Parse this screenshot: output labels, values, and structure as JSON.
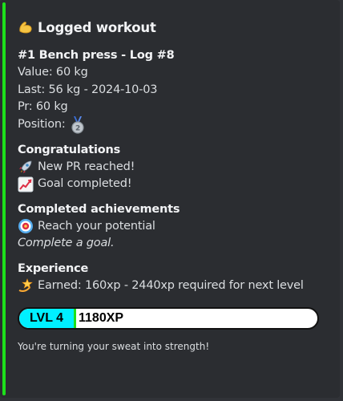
{
  "embed": {
    "accent_color": "#1ee01b",
    "title": "Logged workout",
    "title_icon": "flexed-biceps-icon",
    "log": {
      "heading": "#1 Bench press - Log #8",
      "value": "Value: 60 kg",
      "last": "Last: 56 kg - 2024-10-03",
      "pr": "Pr: 60 kg",
      "position": "Position:",
      "position_icon": "second-place-medal-icon"
    },
    "congratulations": {
      "heading": "Congratulations",
      "items": [
        {
          "icon": "rocket-icon",
          "text": "New PR reached!"
        },
        {
          "icon": "chart-increasing-icon",
          "text": "Goal completed!"
        }
      ]
    },
    "achievements": {
      "heading": "Completed achievements",
      "name": "Reach your potential",
      "icon": "target-icon",
      "description": "Complete a goal."
    },
    "experience": {
      "heading": "Experience",
      "icon": "dizzy-star-icon",
      "earned": "Earned: 160xp - 2440xp required for next level"
    },
    "xp_bar": {
      "level_label": "LVL 4",
      "xp_label": "1180XP",
      "level_color": "#00f0ff",
      "progress": 0.0
    },
    "footer": "You're turning your sweat into strength!"
  }
}
